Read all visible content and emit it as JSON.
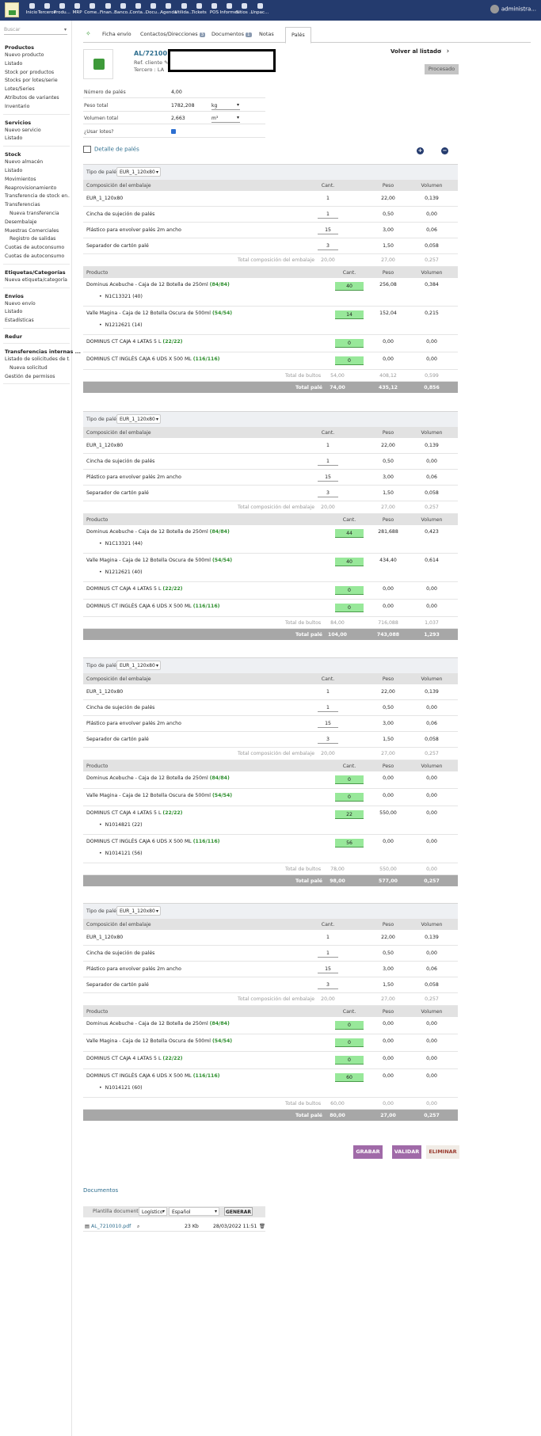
{
  "topbar": {
    "menu": [
      "Inicio",
      "Terceros",
      "Produ...",
      "MRP",
      "Come...",
      "Finan...",
      "Banco...",
      "Conta...",
      "Docu...",
      "Agenda",
      "Utilida...",
      "Tickets",
      "POS",
      "Informes",
      "Sitios ...",
      "Unpac..."
    ],
    "user": "administra..."
  },
  "sidebar": {
    "search_placeholder": "Buscar",
    "sections": [
      {
        "title": "Productos",
        "items": [
          "Nuevo producto",
          "Listado",
          "Stock por productos",
          "Stocks por lotes/serie",
          "Lotes/Series",
          "Atributos de variantes",
          "Inventario"
        ]
      },
      {
        "title": "Servicios",
        "items": [
          "Nuevo servicio",
          "Listado"
        ]
      },
      {
        "title": "Stock",
        "items": [
          "Nuevo almacén",
          "Listado",
          "Movimientos",
          "Reaprovisionamiento",
          "Transferencia de stock en...",
          "Transferencias",
          "Nueva transferencia",
          "Desembalaje",
          "Muestras Comerciales",
          "Registro de salidas",
          "Cuotas de autoconsumo",
          "Cuotas de autoconsumo"
        ]
      },
      {
        "title": "Etiquetas/Categorías",
        "items": [
          "Nueva etiqueta/categoría"
        ]
      },
      {
        "title": "Envíos",
        "items": [
          "Nuevo envío",
          "Listado",
          "Estadísticas"
        ]
      },
      {
        "title": "Redur",
        "items": []
      },
      {
        "title": "Transferencias internas ...",
        "items": [
          "Listado de solicitudes de t...",
          "Nueva solicitud",
          "Gestión de permisos"
        ]
      }
    ]
  },
  "tabs": [
    {
      "label": "Ficha envío",
      "count": ""
    },
    {
      "label": "Contactos/Direcciones",
      "count": "3"
    },
    {
      "label": "Documentos",
      "count": "1"
    },
    {
      "label": "Notas",
      "count": ""
    },
    {
      "label": "Palés",
      "count": ""
    }
  ],
  "header": {
    "ref": "AL/7210010",
    "ref_cliente_label": "Ref. cliente",
    "tercero_label": "Tercero :",
    "tercero_value": "LA",
    "volver": "Volver al listado",
    "prev": "‹",
    "next": "›",
    "estado": "Procesado"
  },
  "props": [
    {
      "label": "Número de palés",
      "value": "4,00",
      "unit": ""
    },
    {
      "label": "Peso total",
      "value": "1782,208",
      "unit": "kg"
    },
    {
      "label": "Volumen total",
      "value": "2,663",
      "unit": "m³"
    },
    {
      "label": "¿Usar lotes?",
      "value": "",
      "unit": ""
    }
  ],
  "detalle_title": "Detalle de palés",
  "plus": "+",
  "minus": "−",
  "labels": {
    "tipo": "Tipo de palé",
    "comp_head": "Composición del embalaje",
    "prod_head": "Producto",
    "cant": "Cant.",
    "peso": "Peso",
    "volumen": "Volumen",
    "total_comp": "Total composición del embalaje",
    "total_bultos": "Total de bultos",
    "total_pale": "Total palé"
  },
  "pallets": [
    {
      "tipo": "EUR_1_120x80",
      "composition": [
        {
          "name": "EUR_1_120x80",
          "qty": "1",
          "weight": "22,00",
          "volume": "0,139"
        },
        {
          "name": "Cincha de sujeción de palés",
          "qty": "1",
          "weight": "0,50",
          "volume": "0,00"
        },
        {
          "name": "Plástico para envolver palés 2m ancho",
          "qty": "15",
          "weight": "3,00",
          "volume": "0,06"
        },
        {
          "name": "Separador de cartón palé",
          "qty": "3",
          "weight": "1,50",
          "volume": "0,058"
        }
      ],
      "comp_total": {
        "qty": "20,00",
        "weight": "27,00",
        "volume": "0,257"
      },
      "products": [
        {
          "name": "Dominus Acebuche - Caja de 12 Botella de 250ml",
          "stock": "(84/84)",
          "qty": "40",
          "weight": "256,08",
          "volume": "0,384",
          "lots": [
            "N1C13321 (40)"
          ]
        },
        {
          "name": "Valle Magina - Caja de 12 Botella Oscura de 500ml",
          "stock": "(54/54)",
          "qty": "14",
          "weight": "152,04",
          "volume": "0,215",
          "lots": [
            "N1212621 (14)"
          ]
        },
        {
          "name": "DOMINUS CT CAJA 4 LATAS 5 L",
          "stock": "(22/22)",
          "qty": "0",
          "weight": "0,00",
          "volume": "0,00",
          "lots": []
        },
        {
          "name": "DOMINUS CT INGLÉS CAJA 6 UDS X 500 ML",
          "stock": "(116/116)",
          "qty": "0",
          "weight": "0,00",
          "volume": "0,00",
          "lots": []
        }
      ],
      "bultos_total": {
        "qty": "54,00",
        "weight": "408,12",
        "volume": "0,599"
      },
      "pale_total": {
        "qty": "74,00",
        "weight": "435,12",
        "volume": "0,856"
      }
    },
    {
      "tipo": "EUR_1_120x80",
      "composition": [
        {
          "name": "EUR_1_120x80",
          "qty": "1",
          "weight": "22,00",
          "volume": "0,139"
        },
        {
          "name": "Cincha de sujeción de palés",
          "qty": "1",
          "weight": "0,50",
          "volume": "0,00"
        },
        {
          "name": "Plástico para envolver palés 2m ancho",
          "qty": "15",
          "weight": "3,00",
          "volume": "0,06"
        },
        {
          "name": "Separador de cartón palé",
          "qty": "3",
          "weight": "1,50",
          "volume": "0,058"
        }
      ],
      "comp_total": {
        "qty": "20,00",
        "weight": "27,00",
        "volume": "0,257"
      },
      "products": [
        {
          "name": "Dominus Acebuche - Caja de 12 Botella de 250ml",
          "stock": "(84/84)",
          "qty": "44",
          "weight": "281,688",
          "volume": "0,423",
          "lots": [
            "N1C13321 (44)"
          ]
        },
        {
          "name": "Valle Magina - Caja de 12 Botella Oscura de 500ml",
          "stock": "(54/54)",
          "qty": "40",
          "weight": "434,40",
          "volume": "0,614",
          "lots": [
            "N1212621 (40)"
          ]
        },
        {
          "name": "DOMINUS CT CAJA 4 LATAS 5 L",
          "stock": "(22/22)",
          "qty": "0",
          "weight": "0,00",
          "volume": "0,00",
          "lots": []
        },
        {
          "name": "DOMINUS CT INGLÉS CAJA 6 UDS X 500 ML",
          "stock": "(116/116)",
          "qty": "0",
          "weight": "0,00",
          "volume": "0,00",
          "lots": []
        }
      ],
      "bultos_total": {
        "qty": "84,00",
        "weight": "716,088",
        "volume": "1,037"
      },
      "pale_total": {
        "qty": "104,00",
        "weight": "743,088",
        "volume": "1,293"
      }
    },
    {
      "tipo": "EUR_1_120x80",
      "composition": [
        {
          "name": "EUR_1_120x80",
          "qty": "1",
          "weight": "22,00",
          "volume": "0,139"
        },
        {
          "name": "Cincha de sujeción de palés",
          "qty": "1",
          "weight": "0,50",
          "volume": "0,00"
        },
        {
          "name": "Plástico para envolver palés 2m ancho",
          "qty": "15",
          "weight": "3,00",
          "volume": "0,06"
        },
        {
          "name": "Separador de cartón palé",
          "qty": "3",
          "weight": "1,50",
          "volume": "0,058"
        }
      ],
      "comp_total": {
        "qty": "20,00",
        "weight": "27,00",
        "volume": "0,257"
      },
      "products": [
        {
          "name": "Dominus Acebuche - Caja de 12 Botella de 250ml",
          "stock": "(84/84)",
          "qty": "0",
          "weight": "0,00",
          "volume": "0,00",
          "lots": []
        },
        {
          "name": "Valle Magina - Caja de 12 Botella Oscura de 500ml",
          "stock": "(54/54)",
          "qty": "0",
          "weight": "0,00",
          "volume": "0,00",
          "lots": []
        },
        {
          "name": "DOMINUS CT CAJA 4 LATAS 5 L",
          "stock": "(22/22)",
          "qty": "22",
          "weight": "550,00",
          "volume": "0,00",
          "lots": [
            "N1014821 (22)"
          ]
        },
        {
          "name": "DOMINUS CT INGLÉS CAJA 6 UDS X 500 ML",
          "stock": "(116/116)",
          "qty": "56",
          "weight": "0,00",
          "volume": "0,00",
          "lots": [
            "N1014121 (56)"
          ]
        }
      ],
      "bultos_total": {
        "qty": "78,00",
        "weight": "550,00",
        "volume": "0,00"
      },
      "pale_total": {
        "qty": "98,00",
        "weight": "577,00",
        "volume": "0,257"
      }
    },
    {
      "tipo": "EUR_1_120x80",
      "composition": [
        {
          "name": "EUR_1_120x80",
          "qty": "1",
          "weight": "22,00",
          "volume": "0,139"
        },
        {
          "name": "Cincha de sujeción de palés",
          "qty": "1",
          "weight": "0,50",
          "volume": "0,00"
        },
        {
          "name": "Plástico para envolver palés 2m ancho",
          "qty": "15",
          "weight": "3,00",
          "volume": "0,06"
        },
        {
          "name": "Separador de cartón palé",
          "qty": "3",
          "weight": "1,50",
          "volume": "0,058"
        }
      ],
      "comp_total": {
        "qty": "20,00",
        "weight": "27,00",
        "volume": "0,257"
      },
      "products": [
        {
          "name": "Dominus Acebuche - Caja de 12 Botella de 250ml",
          "stock": "(84/84)",
          "qty": "0",
          "weight": "0,00",
          "volume": "0,00",
          "lots": []
        },
        {
          "name": "Valle Magina - Caja de 12 Botella Oscura de 500ml",
          "stock": "(54/54)",
          "qty": "0",
          "weight": "0,00",
          "volume": "0,00",
          "lots": []
        },
        {
          "name": "DOMINUS CT CAJA 4 LATAS 5 L",
          "stock": "(22/22)",
          "qty": "0",
          "weight": "0,00",
          "volume": "0,00",
          "lots": []
        },
        {
          "name": "DOMINUS CT INGLÉS CAJA 6 UDS X 500 ML",
          "stock": "(116/116)",
          "qty": "60",
          "weight": "0,00",
          "volume": "0,00",
          "lots": [
            "N1014121 (60)"
          ]
        }
      ],
      "bultos_total": {
        "qty": "60,00",
        "weight": "0,00",
        "volume": "0,00"
      },
      "pale_total": {
        "qty": "80,00",
        "weight": "27,00",
        "volume": "0,257"
      }
    }
  ],
  "actions": {
    "save": "GRABAR",
    "validate": "VALIDAR",
    "delete": "ELIMINAR",
    "save_color": "#a06aa8",
    "delete_bg": "#f1ece6",
    "delete_color": "#9a3a2e"
  },
  "documents": {
    "title": "Documentos",
    "plantilla_label": "Plantilla documento",
    "model": "Logístico",
    "lang": "Español",
    "generate": "GENERAR",
    "file": "AL_7210010.pdf",
    "size": "23 Kb",
    "date": "28/03/2022 11:51"
  },
  "colors": {
    "topbar": "#243b6e",
    "accent": "#2f6f8f",
    "qty_green": "#98e89a"
  }
}
